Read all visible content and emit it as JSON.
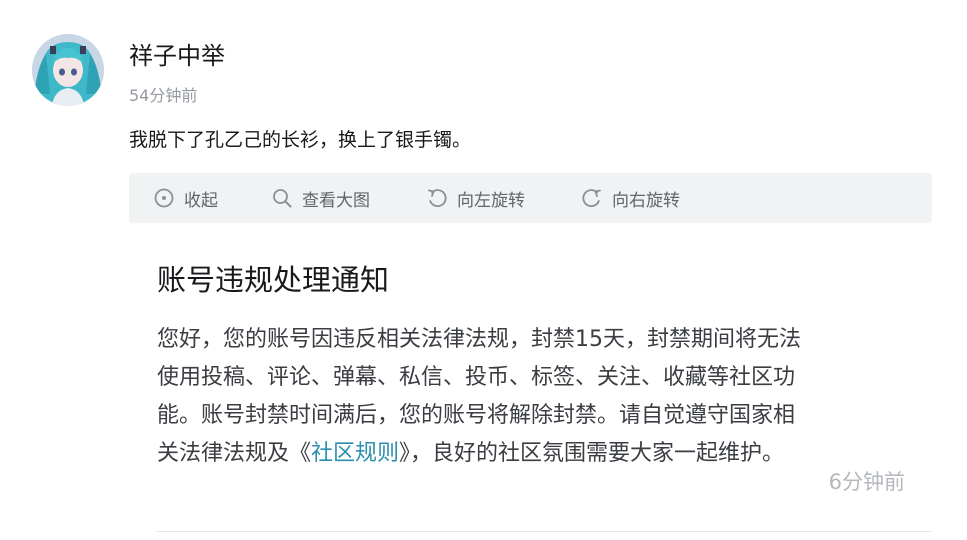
{
  "post": {
    "username": "祥子中举",
    "time": "54分钟前",
    "text": "我脱下了孔乙己的长衫，换上了银手镯。"
  },
  "toolbar": {
    "items": [
      {
        "label": "收起",
        "icon": "collapse-icon"
      },
      {
        "label": "查看大图",
        "icon": "search-icon"
      },
      {
        "label": "向左旋转",
        "icon": "rotate-left-icon"
      },
      {
        "label": "向右旋转",
        "icon": "rotate-right-icon"
      }
    ]
  },
  "notice": {
    "title": "账号违规处理通知",
    "lines": [
      "您好，您的账号因违反相关法律法规，封禁15天，封禁期间将无法",
      "使用投稿、评论、弹幕、私信、投币、标签、关注、收藏等社区功",
      "能。账号封禁时间满后，您的账号将解除封禁。请自觉遵守国家相"
    ],
    "last_line_before": "关法律法规及《",
    "link_text": "社区规则",
    "last_line_after": "》，良好的社区氛围需要大家一起维护。",
    "time": "6分钟前"
  },
  "colors": {
    "link": "#2b8fb0",
    "muted": "#9499a0",
    "toolbar_bg": "#f1f2f3"
  }
}
